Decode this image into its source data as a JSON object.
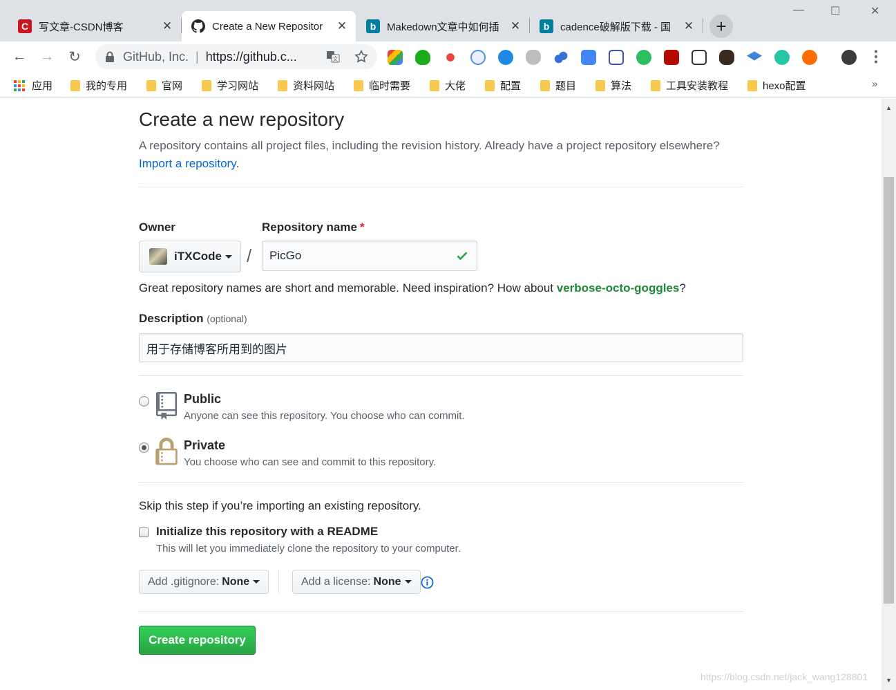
{
  "browser": {
    "tabs": [
      {
        "title": "写文章-CSDN博客",
        "icon": "csdn-icon",
        "color": "#c91623",
        "active": false
      },
      {
        "title": "Create a New Repositor",
        "icon": "github-icon",
        "color": "#24292e",
        "active": true
      },
      {
        "title": "Makedown文章中如何插",
        "icon": "bing-icon",
        "color": "#00809d",
        "active": false
      },
      {
        "title": "cadence破解版下载 - 国",
        "icon": "bing-icon",
        "color": "#00809d",
        "active": false
      }
    ],
    "close_glyph": "✕",
    "new_tab_glyph": "+",
    "window_controls": {
      "minimize": "—",
      "maximize": "☐",
      "close": "✕"
    },
    "nav": {
      "back": "←",
      "forward": "→",
      "reload": "↻"
    },
    "omnibox": {
      "site": "GitHub, Inc.",
      "separator": "|",
      "url": "https://github.c..."
    },
    "bookmarks": [
      "应用",
      "我的专用",
      "官网",
      "学习网站",
      "资料网站",
      "临时需要",
      "大佬",
      "配置",
      "题目",
      "算法",
      "工具安装教程",
      "hexo配置"
    ],
    "bookmarks_more": "»"
  },
  "page": {
    "title": "Create a new repository",
    "lead_text": "A repository contains all project files, including the revision history. Already have a project repository elsewhere?",
    "import_link": "Import a repository",
    "import_period": ".",
    "owner_label": "Owner",
    "repo_name_label": "Repository name",
    "required_mark": "*",
    "owner_value": "iTXCode",
    "slash": "/",
    "repo_name_value": "PicGo",
    "name_hint_prefix": "Great repository names are short and memorable. Need inspiration? How about ",
    "name_hint_suggestion": "verbose-octo-goggles",
    "name_hint_suffix": "?",
    "description_label": "Description",
    "description_optional": "(optional)",
    "description_value": "用于存储博客所用到的图片",
    "visibility": {
      "selected": "private",
      "public_title": "Public",
      "public_desc": "Anyone can see this repository. You choose who can commit.",
      "private_title": "Private",
      "private_desc": "You choose who can see and commit to this repository."
    },
    "skip_text": "Skip this step if you’re importing an existing repository.",
    "init_readme_label": "Initialize this repository with a README",
    "init_readme_desc": "This will let you immediately clone the repository to your computer.",
    "init_readme_checked": false,
    "gitignore_label": "Add .gitignore:",
    "gitignore_value": "None",
    "license_label": "Add a license:",
    "license_value": "None",
    "create_button": "Create repository",
    "watermark": "https://blog.csdn.net/jack_wang128801"
  },
  "colors": {
    "link": "#0366d6",
    "primary_button": "#28a745",
    "valid_check": "#28a745",
    "required": "#cb2431"
  }
}
